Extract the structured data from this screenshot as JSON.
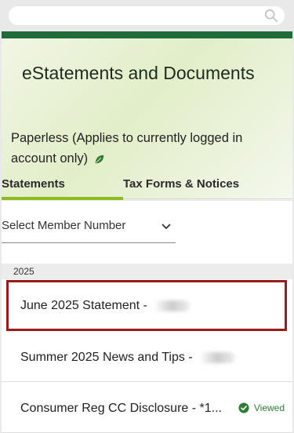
{
  "search": {
    "placeholder": ""
  },
  "hero": {
    "title": "eStatements and Documents",
    "paperless_text": "Paperless (Applies to currently logged in account only)"
  },
  "tabs": [
    {
      "label": "Statements",
      "active": true
    },
    {
      "label": "Tax Forms & Notices",
      "active": false
    }
  ],
  "member_select": {
    "value": "Select Member Number"
  },
  "year": "2025",
  "documents": [
    {
      "label": "June 2025 Statement - ",
      "selected": true
    },
    {
      "label": "Summer 2025 News and Tips - ",
      "selected": false
    },
    {
      "label": "Consumer Reg CC Disclosure - *1...",
      "status": "Viewed"
    }
  ],
  "colors": {
    "brand_green": "#1f6b3a",
    "tab_accent": "#8bbd1f",
    "selection_border": "#9b1b1b",
    "viewed_green": "#2e7d32"
  }
}
